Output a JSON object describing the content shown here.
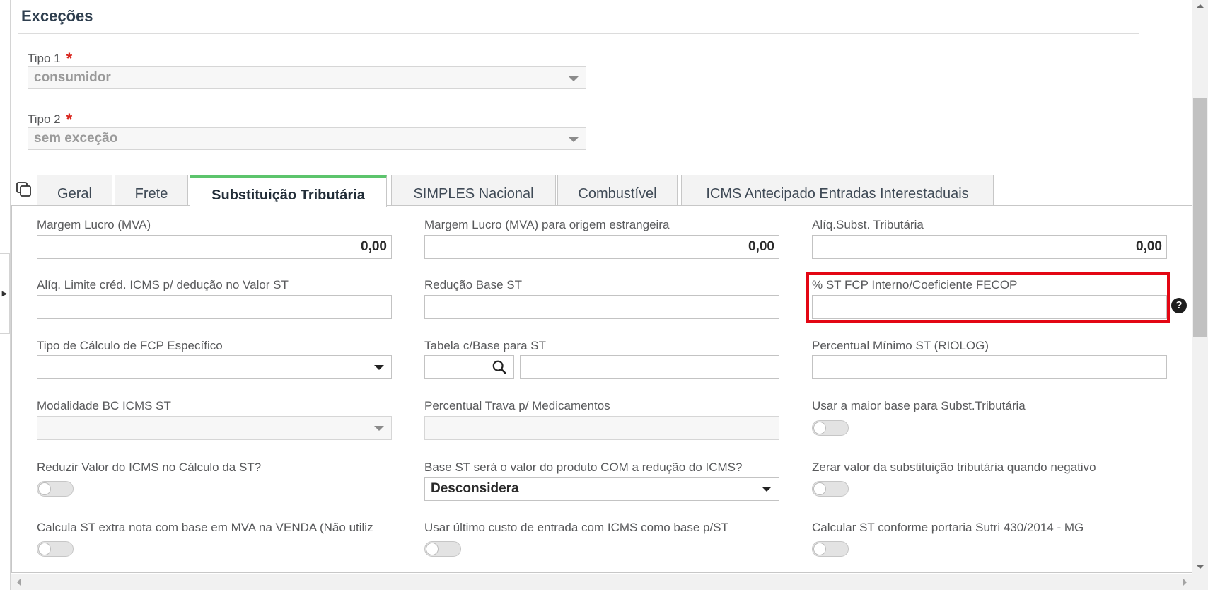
{
  "section": {
    "title": "Exceções"
  },
  "tipo1": {
    "label": "Tipo 1",
    "required_mark": "*",
    "value": "consumidor"
  },
  "tipo2": {
    "label": "Tipo 2",
    "required_mark": "*",
    "value": "sem exceção"
  },
  "tabs": [
    {
      "label": "Geral",
      "active": false
    },
    {
      "label": "Frete",
      "active": false
    },
    {
      "label": "Substituição Tributária",
      "active": true
    },
    {
      "label": "SIMPLES Nacional",
      "active": false
    },
    {
      "label": "Combustível",
      "active": false
    },
    {
      "label": "ICMS Antecipado Entradas Interestaduais",
      "active": false
    }
  ],
  "fields": {
    "margem_lucro": {
      "label": "Margem Lucro (MVA)",
      "value": "0,00"
    },
    "margem_lucro_estrangeira": {
      "label": "Margem Lucro (MVA) para origem estrangeira",
      "value": "0,00"
    },
    "aliq_subst": {
      "label": "Alíq.Subst. Tributária",
      "value": "0,00"
    },
    "aliq_limite": {
      "label": "Alíq. Limite créd. ICMS p/ dedução no Valor ST",
      "value": ""
    },
    "reducao_base": {
      "label": "Redução Base ST",
      "value": ""
    },
    "st_fcp": {
      "label": "% ST FCP Interno/Coeficiente FECOP",
      "value": ""
    },
    "tipo_calculo_fcp": {
      "label": "Tipo de Cálculo de FCP Específico",
      "value": ""
    },
    "tabela_base": {
      "label": "Tabela c/Base para ST",
      "code": "",
      "description": ""
    },
    "percentual_minimo": {
      "label": "Percentual Mínimo ST (RIOLOG)",
      "value": ""
    },
    "modalidade_bc": {
      "label": "Modalidade BC ICMS ST",
      "value": ""
    },
    "percentual_trava": {
      "label": "Percentual Trava p/ Medicamentos",
      "value": ""
    },
    "usar_maior_base": {
      "label": "Usar a maior base para Subst.Tributária",
      "on": false
    },
    "reduzir_icms": {
      "label": "Reduzir Valor do ICMS no Cálculo da ST?",
      "on": false
    },
    "base_st_valor": {
      "label": "Base ST será o valor do produto COM a redução do ICMS?",
      "value": "Desconsidera"
    },
    "zerar_valor": {
      "label": "Zerar valor da substituição tributária quando negativo",
      "on": false
    },
    "calcula_st_extra": {
      "label": "Calcula ST extra nota com base em MVA na VENDA (Não utiliz",
      "on": false
    },
    "usar_ultimo_custo": {
      "label": "Usar último custo de entrada com ICMS como base p/ST",
      "on": false
    },
    "calcular_sutri": {
      "label": "Calcular ST conforme portaria Sutri 430/2014 - MG",
      "on": false
    }
  },
  "icons": {
    "help": "?",
    "side_toggle": "▶"
  },
  "colors": {
    "active_tab_accent": "#5cc46c",
    "highlight_border": "#e30613",
    "required": "#d9241c"
  }
}
